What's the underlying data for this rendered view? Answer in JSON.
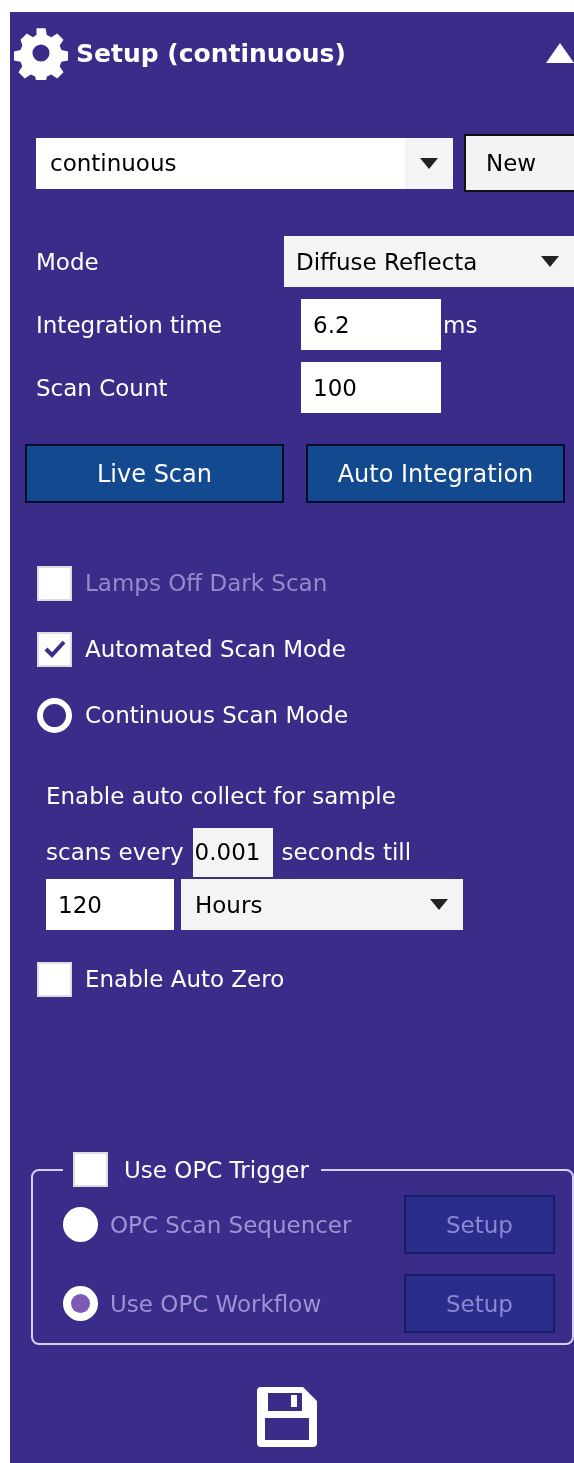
{
  "header": {
    "title": "Setup (continuous)",
    "expanded": true
  },
  "method": {
    "value": "continuous",
    "new_button": "New"
  },
  "fields": [
    {
      "kind": "dropdown",
      "label": "Mode",
      "value": "Diffuse Reflecta"
    },
    {
      "kind": "input",
      "label": "Integration time",
      "value": "6.2",
      "unit": "ms"
    },
    {
      "kind": "input",
      "label": "Scan Count",
      "value": "100"
    }
  ],
  "actions": [
    "Live Scan",
    "Auto Integration"
  ],
  "options": [
    {
      "kind": "checkbox",
      "label": "Lamps Off Dark Scan",
      "checked": false,
      "disabled": true
    },
    {
      "kind": "checkbox",
      "label": "Automated Scan Mode",
      "checked": true,
      "disabled": false
    },
    {
      "kind": "radio",
      "label": "Continuous Scan Mode",
      "selected": false,
      "disabled": false
    }
  ],
  "auto_collect": {
    "line_1": "Enable auto collect for sample",
    "prefix": "scans every",
    "interval": "0.001",
    "suffix": "seconds till",
    "duration": "120",
    "unit": "Hours"
  },
  "auto_zero": {
    "label": "Enable Auto Zero",
    "checked": false
  },
  "opc": {
    "label": "Use OPC Trigger",
    "checked": false,
    "options": [
      {
        "label": "OPC Scan Sequencer",
        "selected": false,
        "disabled": true,
        "button": "Setup"
      },
      {
        "label": "Use OPC Workflow",
        "selected": true,
        "disabled": true,
        "button": "Setup"
      }
    ]
  }
}
